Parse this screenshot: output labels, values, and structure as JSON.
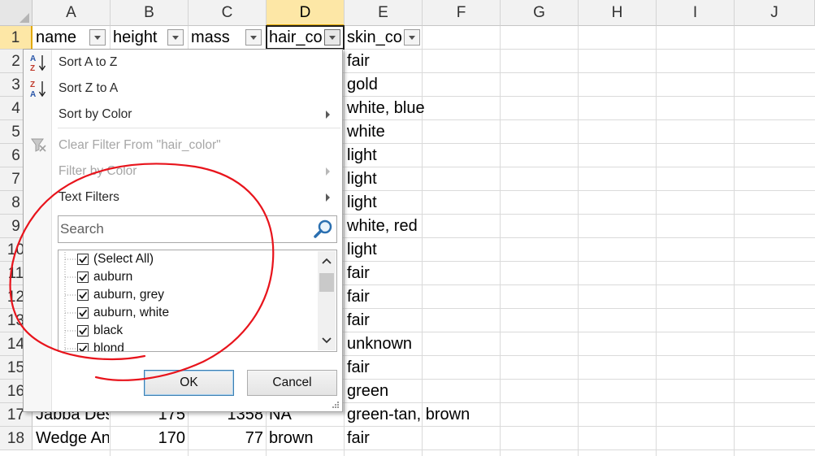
{
  "columns": [
    "A",
    "B",
    "C",
    "D",
    "E",
    "F",
    "G",
    "H",
    "I",
    "J"
  ],
  "active_column": "D",
  "rows": [
    1,
    2,
    3,
    4,
    5,
    6,
    7,
    8,
    9,
    10,
    11,
    12,
    13,
    14,
    15,
    16,
    17,
    18
  ],
  "headers": {
    "a": "name",
    "b": "height",
    "c": "mass",
    "d": "hair_co",
    "e": "skin_co"
  },
  "skin_color_values": [
    "fair",
    "gold",
    "white, blue",
    "white",
    "light",
    "light",
    "light",
    "white, red",
    "light",
    "fair",
    "fair",
    "fair",
    "unknown",
    "fair",
    "green",
    "green-tan, brown",
    "fair"
  ],
  "row17": {
    "name": "Jabba Des",
    "height": "175",
    "mass": "1358",
    "hair": "NA"
  },
  "row18": {
    "name": "Wedge An",
    "height": "170",
    "mass": "77",
    "hair": "brown"
  },
  "menu": {
    "sort_az": "Sort A to Z",
    "sort_za": "Sort Z to A",
    "sort_color": "Sort by Color",
    "clear_filter": "Clear Filter From \"hair_color\"",
    "filter_color": "Filter by Color",
    "text_filters": "Text Filters",
    "search_placeholder": "Search",
    "ok": "OK",
    "cancel": "Cancel"
  },
  "filter_list": [
    "(Select All)",
    "auburn",
    "auburn, grey",
    "auburn, white",
    "black",
    "blond"
  ],
  "colors": {
    "annotation": "#e8141c",
    "active_header": "#fde7a6",
    "ok_border": "#3c7fb1"
  }
}
